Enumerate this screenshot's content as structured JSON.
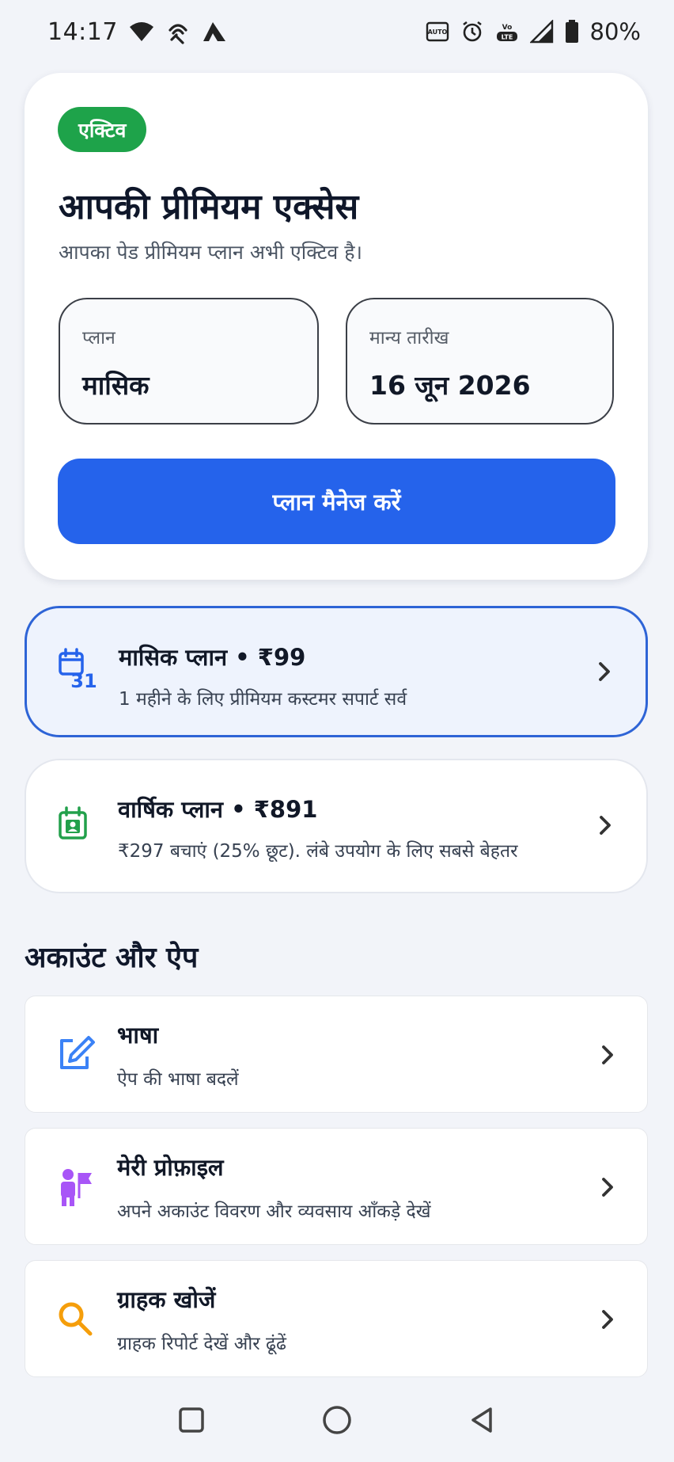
{
  "status_bar": {
    "time": "14:17",
    "battery": "80%",
    "left_icons": [
      "wifi-icon",
      "hotspot-icon",
      "app-notification-icon"
    ],
    "right_icons": [
      "auto-brightness-icon",
      "alarm-icon",
      "volte-icon",
      "signal-icon",
      "battery-icon"
    ]
  },
  "premium_card": {
    "badge": "एक्टिव",
    "title": "आपकी प्रीमियम एक्सेस",
    "subtitle": "आपका पेड प्रीमियम प्लान अभी एक्टिव है।",
    "plan_label": "प्लान",
    "plan_value": "मासिक",
    "validity_label": "मान्य तारीख",
    "validity_value": "16 जून 2026",
    "manage_button": "प्लान मैनेज करें"
  },
  "plans": [
    {
      "title": "मासिक प्लान • ₹99",
      "description": "1 महीने के लिए प्रीमियम कस्टमर सपार्ट सर्व",
      "icon": "calendar-31-icon",
      "icon_color": "#2563eb",
      "selected": true
    },
    {
      "title": "वार्षिक प्लान • ₹891",
      "description": "₹297 बचाएं (25% छूट). लंबे उपयोग के लिए सबसे बेहतर",
      "icon": "calendar-badge-icon",
      "icon_color": "#22a04b",
      "selected": false
    }
  ],
  "section": {
    "title": "अकाउंट और ऐप"
  },
  "settings_items": [
    {
      "title": "भाषा",
      "description": "ऐप की भाषा बदलें",
      "icon": "edit-icon",
      "icon_color": "#3b82f6"
    },
    {
      "title": "मेरी प्रोफ़ाइल",
      "description": "अपने अकाउंट विवरण और व्यवसाय आँकड़े देखें",
      "icon": "profile-flag-icon",
      "icon_color": "#a855f7"
    },
    {
      "title": "ग्राहक खोजें",
      "description": "ग्राहक रिपोर्ट देखें और ढूंढें",
      "icon": "search-icon",
      "icon_color": "#f59e0b"
    }
  ],
  "nav_bar": {
    "buttons": [
      "recents-button",
      "home-button",
      "back-button"
    ]
  },
  "colors": {
    "background": "#f2f4f9",
    "primary": "#2563eb",
    "active_badge": "#1ea34a"
  }
}
